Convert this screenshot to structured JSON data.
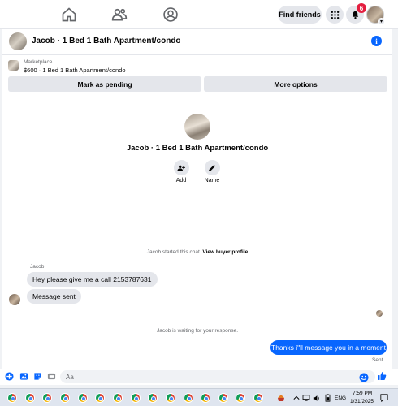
{
  "nav": {
    "find_friends_label": "Find friends",
    "notification_count": "6"
  },
  "chat": {
    "header_title": "Jacob · 1 Bed 1 Bath Apartment/condo",
    "marketplace": {
      "label": "Marketplace",
      "listing": "$600 · 1 Bed 1 Bath Apartment/condo",
      "pending_button": "Mark as pending",
      "more_button": "More options"
    },
    "profile": {
      "name": "Jacob · 1 Bed 1 Bath Apartment/condo",
      "add_label": "Add",
      "name_label": "Name"
    },
    "started_text": "Jacob started this chat.",
    "view_profile_link": "View buyer profile",
    "sender_name": "Jacob",
    "messages_in": [
      "Hey please give me a call 2153787631",
      "Message sent"
    ],
    "waiting_text": "Jacob is waiting for your response.",
    "message_out": "Thanks i\"ll message you in a moment",
    "sent_label": "Sent"
  },
  "composer": {
    "placeholder": "Aa"
  },
  "taskbar": {
    "language": "ENG",
    "time": "7:59 PM",
    "date": "1/31/2025"
  },
  "colors": {
    "accent": "#0866ff",
    "badge": "#e41e3f",
    "bubble_in": "#e4e6eb"
  }
}
